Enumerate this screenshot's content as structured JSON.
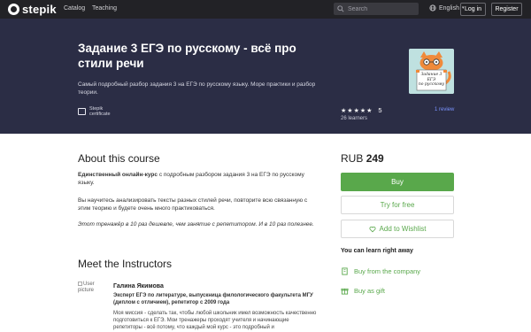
{
  "nav": {
    "logo": "stepik",
    "links": [
      "Catalog",
      "Teaching"
    ],
    "search_placeholder": "Search",
    "language": "English",
    "login": "Log in",
    "register": "Register"
  },
  "hero": {
    "title": "Задание 3 ЕГЭ по русскому - всё про стили речи",
    "description": "Самый подробный разбор задания 3 на ЕГЭ по русскому языку. Море практики и разбор теории.",
    "certificate_line1": "Stepik",
    "certificate_line2": "certificate",
    "rating": "5",
    "stars": 5,
    "reviews": "1 review",
    "learners": "26 learners",
    "cover_text_line1": "Задание 3",
    "cover_text_line2": "ЕГЭ",
    "cover_text_line3": "по русскому"
  },
  "about": {
    "heading": "About this course",
    "p1_bold": "Единственный онлайн-курс",
    "p1_rest": " с подробным разбором задания 3 на ЕГЭ по русскому языку.",
    "p2": "Вы научитесь анализировать тексты разных стилей речи, повторите всю связанную с этим теорию и будете очень много практиковаться.",
    "p3": "Этот тренажёр в 10 раз дешевле, чем занятие с репетитором. И в 10 раз полезнее."
  },
  "instructors": {
    "heading": "Meet the Instructors",
    "avatar_alt": "User picture",
    "name": "Галина Якимова",
    "title": "Эксперт ЕГЭ по литературе, выпускница филологического факультета МГУ (диплом с отличием), репетитор с 2009 года",
    "bio": "Моя миссия - сделать так, чтобы любой школьник имел возможность качественно подготовиться к ЕГЭ. Мои тренажеры проходят учителя и начинающие репетиторы - всё потому, что каждый мой курс - это подробный и"
  },
  "sidebar": {
    "currency": "RUB",
    "price": "249",
    "buy": "Buy",
    "try": "Try for free",
    "wishlist": "Add to Wishlist",
    "learn_right": "You can learn right away",
    "buy_company": "Buy from the company",
    "buy_gift": "Buy as gift"
  },
  "colors": {
    "nav_bg": "#222226",
    "hero_bg": "#2b2d45",
    "accent_green": "#59a84b",
    "link_blue": "#7a93ff"
  }
}
